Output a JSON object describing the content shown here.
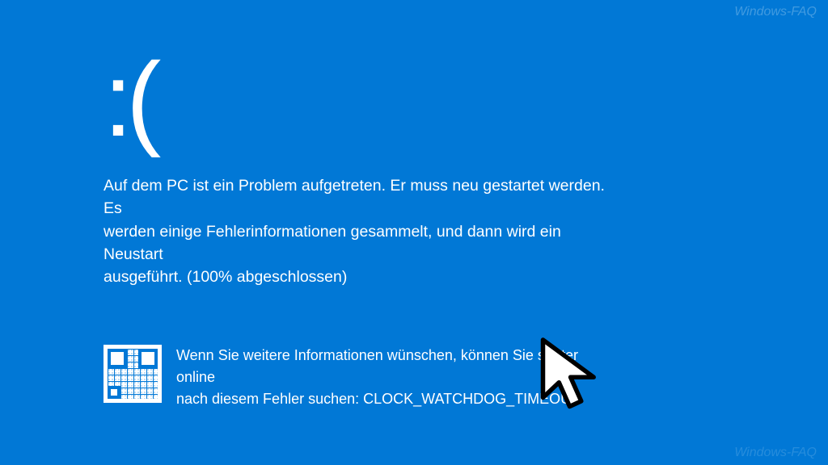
{
  "sad_face": ":(",
  "message_line1": "Auf dem PC ist ein Problem aufgetreten. Er muss neu gestartet werden. Es",
  "message_line2": "werden einige Fehlerinformationen gesammelt, und dann wird ein Neustart",
  "message_line3": "ausgeführt. (100% abgeschlossen)",
  "info_line1": "Wenn Sie weitere Informationen wünschen, können Sie später online",
  "info_line2": "nach diesem Fehler suchen: CLOCK_WATCHDOG_TIMEOUT",
  "watermark": "Windows-FAQ",
  "progress_percent": 100,
  "error_code": "CLOCK_WATCHDOG_TIMEOUT"
}
